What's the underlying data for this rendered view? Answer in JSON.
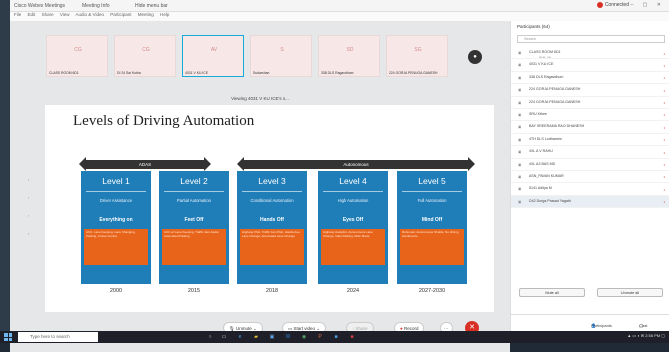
{
  "titlebar": {
    "title": "Cisco Webex Meetings",
    "meeting_info": "Meeting Info",
    "hide_menu": "Hide menu bar",
    "status": "Connected"
  },
  "menu": [
    "File",
    "Edit",
    "Share",
    "View",
    "Audio & Video",
    "Participant",
    "Meeting",
    "Help"
  ],
  "thumbnails": [
    {
      "initials": "CG",
      "label": "CLASS ROOM 6D1",
      "selected": false
    },
    {
      "initials": "CG",
      "label": "DI 24 Sai Kotha",
      "selected": false
    },
    {
      "initials": "AV",
      "label": "4031 V KU ICE",
      "selected": true
    },
    {
      "initials": "S",
      "label": "Sudarshan",
      "selected": false
    },
    {
      "initials": "SD",
      "label": "338 DLS Ragavdhum",
      "selected": false
    },
    {
      "initials": "SG",
      "label": "224 GORJA PENUGA GANESH",
      "selected": false
    }
  ],
  "viewing_text": "Viewing 4031 V KU ICE's s...",
  "slide": {
    "title": "Levels of  Driving Automation",
    "adas_label": "ADAS",
    "autonomous_label": "Autonomous",
    "levels": [
      {
        "name": "Level 1",
        "desc": "Driver Assistance",
        "key": "Everything on",
        "detail": "ACC, Lane Keeping, Lane Changing, Parking, Cruise Control",
        "year": "2000"
      },
      {
        "name": "Level 2",
        "desc": "Partial Automation",
        "key": "Feet Off",
        "detail": "ACC w/ Lane Keeping, Traffic Jam Assist, Automated Parking",
        "year": "2015"
      },
      {
        "name": "Level 3",
        "desc": "Conditional Automation",
        "key": "Hands Off",
        "detail": "Highway Pilot, Traffic Jam Pilot, Hands-free Lane Change, Automated Lane Change",
        "year": "2018"
      },
      {
        "name": "Level 4",
        "desc": "High Automation",
        "key": "Eyes Off",
        "detail": "Highway Autopilot, Autonomous Lane Change, Valet Parking, Ride Share",
        "year": "2024"
      },
      {
        "name": "Level 5",
        "desc": "Full Automation",
        "key": "Mind Off",
        "detail": "Robo-taxi, Autonomous Shuttle, No driving interference",
        "year": "2027-2030"
      }
    ]
  },
  "controls": {
    "unmute": "Unmute",
    "start_video": "Start video",
    "share": "Share",
    "record": "Record",
    "more": "···",
    "end": "✕"
  },
  "panel": {
    "header": "Participants (64)",
    "search_placeholder": "Search",
    "participants": [
      {
        "name": "CLASS ROOM 6D1",
        "sub": "Host, me",
        "mic": "•"
      },
      {
        "name": "4031 V KU ICE",
        "sub": "",
        "mic": "•"
      },
      {
        "name": "338 DLS Ragavdhum",
        "sub": "",
        "mic": "•"
      },
      {
        "name": "224 GORJA PENUGA GANESH",
        "sub": "",
        "mic": "•"
      },
      {
        "name": "224 GORJA PENUGA GANESH",
        "sub": "",
        "mic": "•"
      },
      {
        "name": "SRU Kthee",
        "sub": "",
        "mic": "•"
      },
      {
        "name": "BAY SREERAMA RAO DHANESH",
        "sub": "",
        "mic": "•"
      },
      {
        "name": "4TH DLS Lorthames",
        "sub": "",
        "mic": "•"
      },
      {
        "name": "4XL A V RAHU",
        "sub": "",
        "mic": "•"
      },
      {
        "name": "4XL A3 BAS MD",
        "sub": "",
        "mic": "•"
      },
      {
        "name": "ASN_PAVAN KUMAR",
        "sub": "",
        "mic": "•"
      },
      {
        "name": "5141 Aditya M",
        "sub": "",
        "mic": "•"
      },
      {
        "name": "D42 Durga Prasad Yagath",
        "sub": "",
        "mic": "•"
      }
    ],
    "mute_all": "Mute all",
    "unmute_all": "Unmute all",
    "footer_participants": "Participants",
    "footer_chat": "Chat"
  },
  "taskbar": {
    "search_placeholder": "Type here to search",
    "clock": "2:56 PM"
  }
}
